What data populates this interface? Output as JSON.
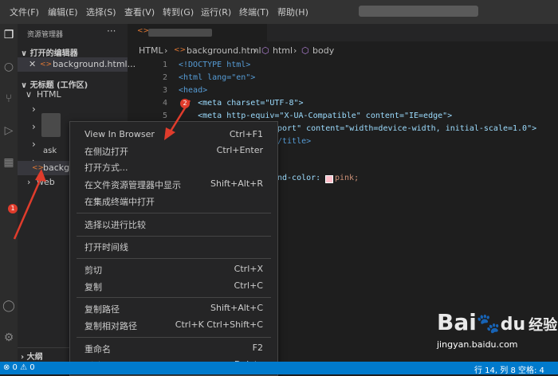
{
  "menubar": {
    "items": [
      "文件(F)",
      "编辑(E)",
      "选择(S)",
      "查看(V)",
      "转到(G)",
      "运行(R)",
      "终端(T)",
      "帮助(H)"
    ]
  },
  "sidebar": {
    "title": "资源管理器",
    "open_editors_label": "打开的编辑器",
    "open_editor_file": "background.html...",
    "workspace_label": "无标题 (工作区)",
    "html_folder": "HTML",
    "item_background_partial": "backgr",
    "item_ask_partial": "ask",
    "item_web_partial": "web",
    "outline_label": "大纲"
  },
  "breadcrumb": {
    "root": "HTML",
    "file": "background.html",
    "node1": "html",
    "node2": "body"
  },
  "editor": {
    "line_numbers": [
      "1",
      "2",
      "3",
      "4",
      "5"
    ],
    "code": {
      "l1": "<!DOCTYPE html>",
      "l2": "<html lang=\"en\">",
      "l3": "<head>",
      "l4": "    <meta charset=\"UTF-8\">",
      "l5": "    <meta http-equiv=\"X-UA-Compatible\" content=\"IE=edge\">",
      "l6": "port\" content=\"width=device-width, initial-scale=1.0\">",
      "l7": "/title>",
      "l8": "nd-color:",
      "l8b": "pink;"
    },
    "swatch_color": "#ffc0cb"
  },
  "context_menu": {
    "items": [
      {
        "label": "View In Browser",
        "key": "Ctrl+F1"
      },
      {
        "label": "在侧边打开",
        "key": "Ctrl+Enter"
      },
      {
        "label": "打开方式...",
        "key": ""
      },
      {
        "label": "在文件资源管理器中显示",
        "key": "Shift+Alt+R"
      },
      {
        "label": "在集成终端中打开",
        "key": ""
      },
      {
        "label": "选择以进行比较",
        "key": ""
      },
      {
        "label": "打开时间线",
        "key": ""
      },
      {
        "label": "剪切",
        "key": "Ctrl+X"
      },
      {
        "label": "复制",
        "key": "Ctrl+C"
      },
      {
        "label": "复制路径",
        "key": "Shift+Alt+C"
      },
      {
        "label": "复制相对路径",
        "key": "Ctrl+K Ctrl+Shift+C"
      },
      {
        "label": "重命名",
        "key": "F2"
      },
      {
        "label": "删除",
        "key": "Delete"
      }
    ]
  },
  "statusbar": {
    "left": "⊗ 0 ⚠ 0",
    "right": "行 14, 列 8   空格: 4"
  },
  "markers": [
    "1",
    "2"
  ],
  "watermark": {
    "logo": "Bai",
    "logo2": "du",
    "text": "经验",
    "url": "jingyan.baidu.com"
  },
  "colors": {
    "accent": "#007acc",
    "marker": "#e03c2c",
    "tag": "#569cd6",
    "attr": "#9cdcfe",
    "string": "#ce9178"
  }
}
